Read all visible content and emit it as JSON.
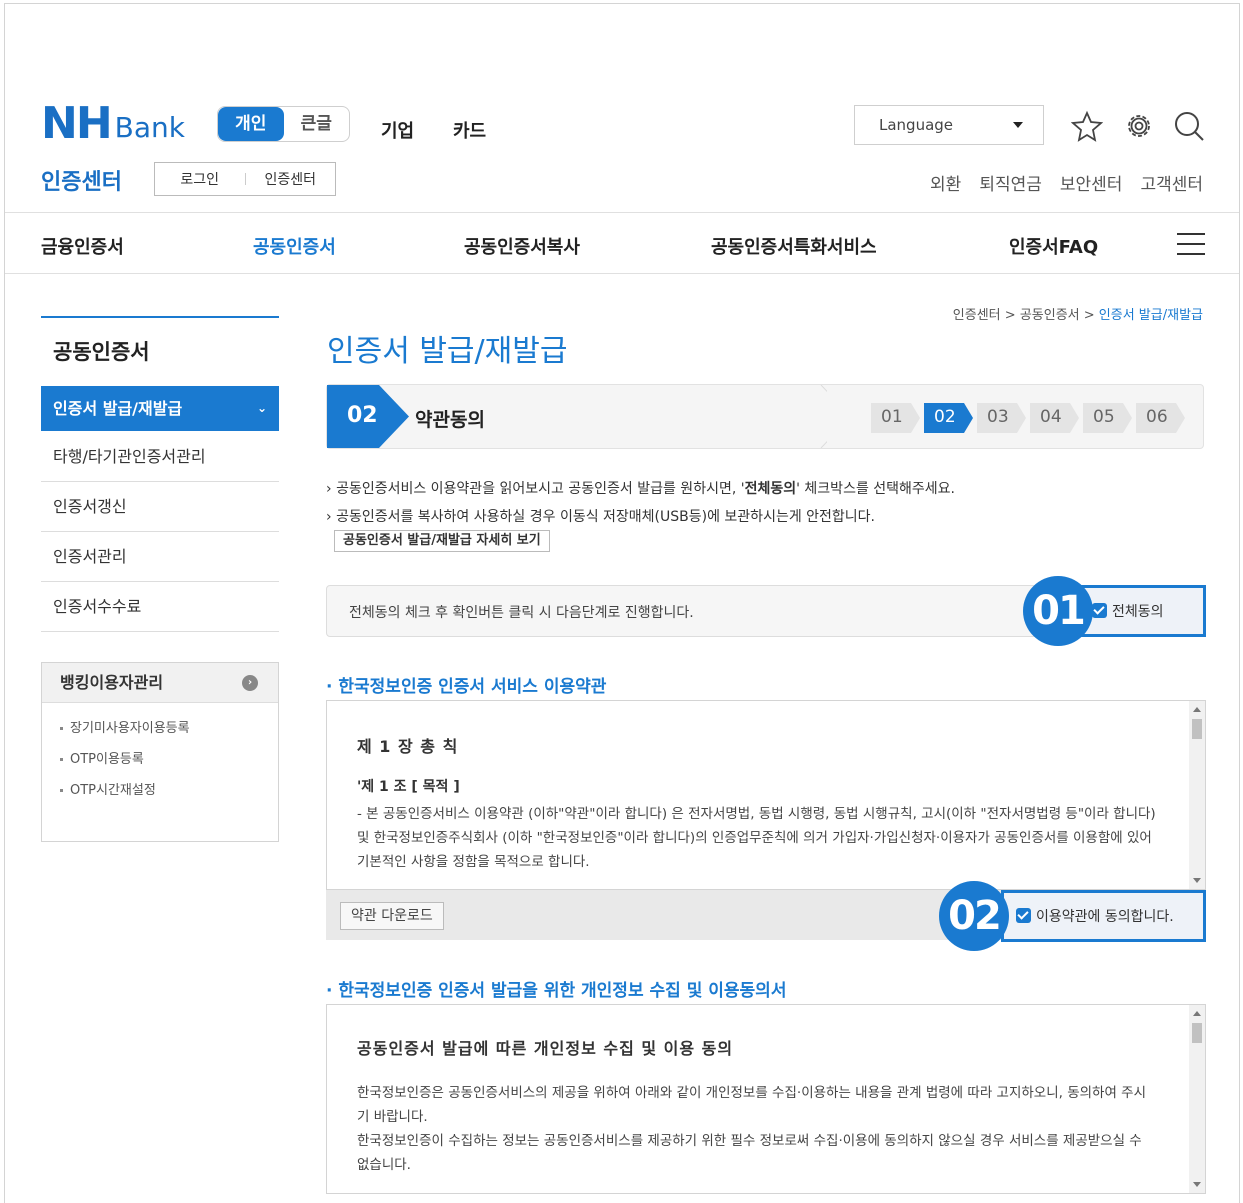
{
  "header": {
    "logo_nh": "NH",
    "logo_bank": "Bank",
    "seg": [
      "개인",
      "큰글"
    ],
    "top_links": [
      "기업",
      "카드"
    ],
    "language": "Language",
    "cert_title": "인증센터",
    "login_box": [
      "로그인",
      "인증센터"
    ],
    "util": [
      "외환",
      "퇴직연금",
      "보안센터",
      "고객센터"
    ]
  },
  "gnb": [
    "금융인증서",
    "공동인증서",
    "공동인증서복사",
    "공동인증서특화서비스",
    "인증서FAQ"
  ],
  "sidebar": {
    "title": "공동인증서",
    "active": "인증서 발급/재발급",
    "items": [
      "타행/타기관인증서관리",
      "인증서갱신",
      "인증서관리",
      "인증서수수료"
    ],
    "bank_title": "뱅킹이용자관리",
    "bank_items": [
      "장기미사용자이용등록",
      "OTP이용등록",
      "OTP시간재설정"
    ]
  },
  "breadcrumb": [
    "인증센터",
    "공동인증서",
    "인증서 발급/재발급"
  ],
  "page_title": "인증서 발급/재발급",
  "step": {
    "num": "02",
    "name": "약관동의",
    "chips": [
      "01",
      "02",
      "03",
      "04",
      "05",
      "06"
    ],
    "current_index": 1
  },
  "notice": {
    "line1_a": "공동인증서비스 이용약관을 읽어보시고 공동인증서 발급를 원하시면, '",
    "line1_b": "전체동의",
    "line1_c": "' 체크박스를 선택해주세요.",
    "line2": "공동인증서를 복사하여 사용하실 경우 이동식 저장매체(USB등)에 보관하시는게 안전합니다.",
    "detail_btn": "공동인증서 발급/재발급 자세히 보기"
  },
  "agree_all": {
    "text": "전체동의 체크 후 확인버튼 클릭 시 다음단계로 진행합니다.",
    "num": "01",
    "label": "전체동의"
  },
  "terms1": {
    "title": "한국정보인증 인증서 서비스 이용약관",
    "chapter": "제 1 장 총 칙",
    "article": "'제 1 조 [ 목적 ]",
    "body": "- 본 공동인증서비스 이용약관 (이하\"약관\"이라 합니다) 은 전자서명법, 동법 시행령, 동법 시행규칙, 고시(이하 \"전자서명법령 등\"이라 합니다) 및 한국정보인증주식회사 (이하 \"한국정보인증\"이라 합니다)의 인증업무준칙에 의거 가입자·가입신청자·이용자가 공동인증서를 이용함에 있어 기본적인 사항을 정함을 목적으로 합니다.",
    "download": "약관 다운로드",
    "num": "02",
    "agree_label": "이용약관에 동의합니다."
  },
  "terms2": {
    "title": "한국정보인증 인증서 발급을 위한 개인정보 수집 및 이용동의서",
    "heading": "공동인증서 발급에 따른 개인정보 수집 및 이용 동의",
    "p1": "한국정보인증은 공동인증서비스의 제공을 위하여 아래와 같이 개인정보를 수집·이용하는 내용을 관계 법령에 따라 고지하오니, 동의하여 주시기 바랍니다.",
    "p2": "한국정보인증이 수집하는 정보는 공동인증서비스를 제공하기 위한 필수 정보로써 수집·이용에 동의하지 않으실 경우 서비스를 제공받으실 수 없습니다."
  },
  "colors": {
    "brand": "#1a7ad0",
    "logo": "#1a6fc4"
  }
}
